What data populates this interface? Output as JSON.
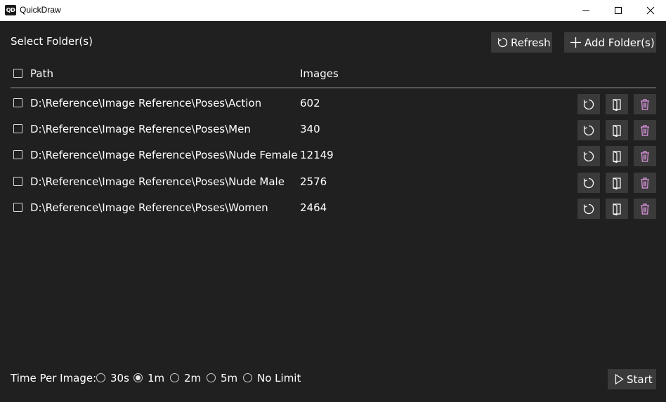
{
  "window": {
    "title": "QuickDraw",
    "icon_text": "QD"
  },
  "header": {
    "title": "Select Folder(s)",
    "refresh_label": "Refresh",
    "add_label": "Add Folder(s)"
  },
  "table": {
    "col_path": "Path",
    "col_images": "Images",
    "rows": [
      {
        "path": "D:\\Reference\\Image Reference\\Poses\\Action",
        "images": "602"
      },
      {
        "path": "D:\\Reference\\Image Reference\\Poses\\Men",
        "images": "340"
      },
      {
        "path": "D:\\Reference\\Image Reference\\Poses\\Nude Female",
        "images": "12149"
      },
      {
        "path": "D:\\Reference\\Image Reference\\Poses\\Nude Male",
        "images": "2576"
      },
      {
        "path": "D:\\Reference\\Image Reference\\Poses\\Women",
        "images": "2464"
      }
    ]
  },
  "footer": {
    "time_label": "Time Per Image:",
    "options": [
      {
        "label": "30s",
        "checked": false
      },
      {
        "label": "1m",
        "checked": true
      },
      {
        "label": "2m",
        "checked": false
      },
      {
        "label": "5m",
        "checked": false
      },
      {
        "label": "No Limit",
        "checked": false
      }
    ],
    "start_label": "Start"
  },
  "colors": {
    "background": "#202020",
    "button": "#3a3a3a",
    "delete_icon": "#e39ae6",
    "titlebar": "#ffffff"
  },
  "icons": {
    "row_refresh": "refresh-icon",
    "row_open": "open-folder-icon",
    "row_delete": "trash-icon"
  }
}
